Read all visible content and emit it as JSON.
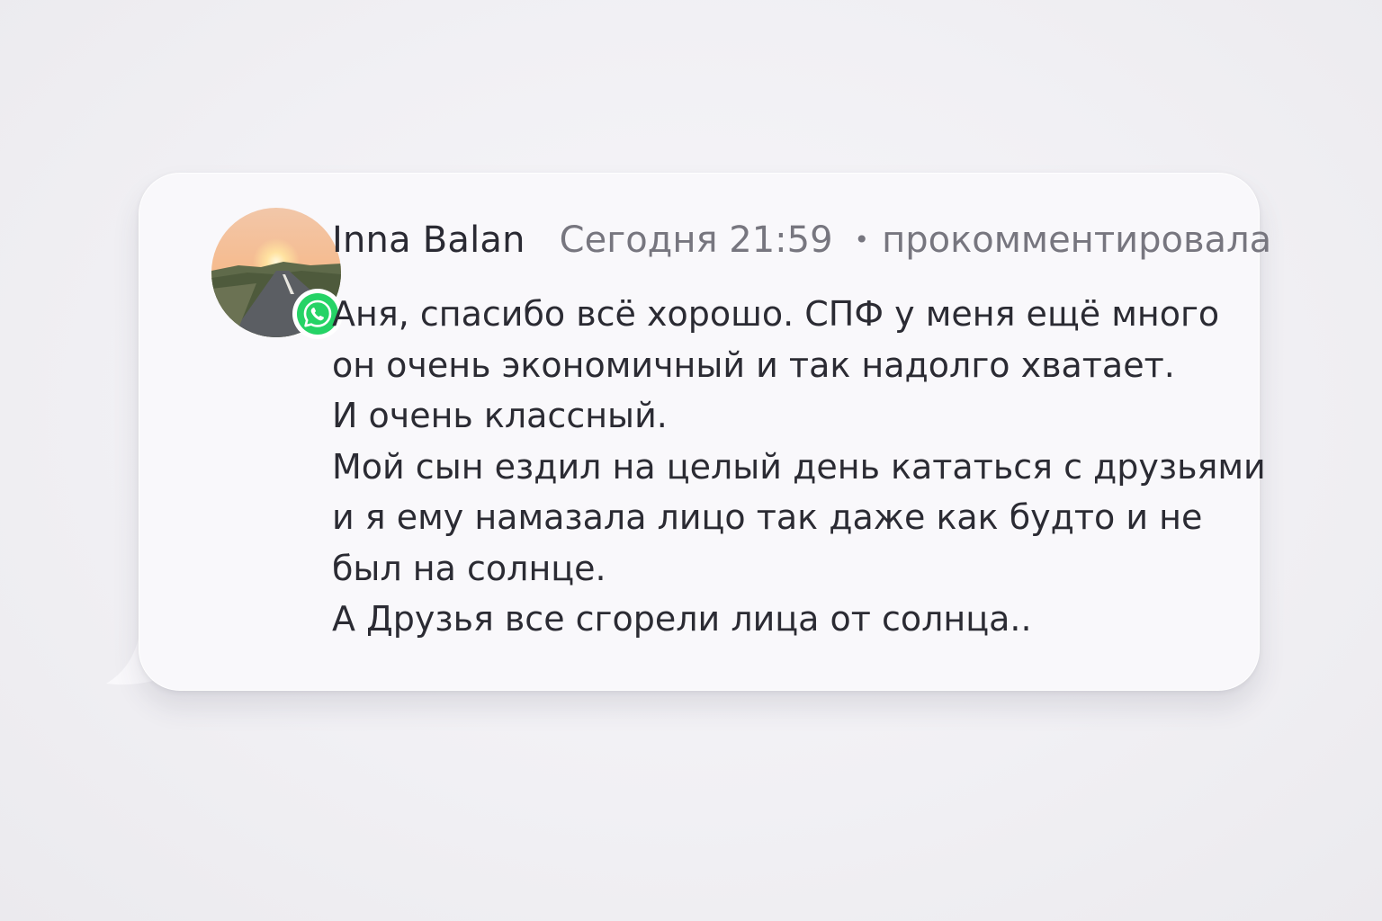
{
  "comment": {
    "author": "Inna Balan",
    "time": "Сегодня 21:59",
    "separator": "•",
    "action": "прокомментировала",
    "avatar_icon": "sunset-road-photo",
    "badge_icon": "whatsapp-icon",
    "badge_color": "#25d366",
    "lines": [
      "Аня, спасибо всё хорошо. СПФ у меня ещё много",
      "он очень экономичный и так надолго хватает.",
      "И очень классный.",
      "Мой сын ездил на целый день кататься с друзьями",
      "и я ему намазала лицо так даже как будто и не",
      "был на солнце.",
      "А Друзья все сгорели лица от солнца.."
    ]
  }
}
